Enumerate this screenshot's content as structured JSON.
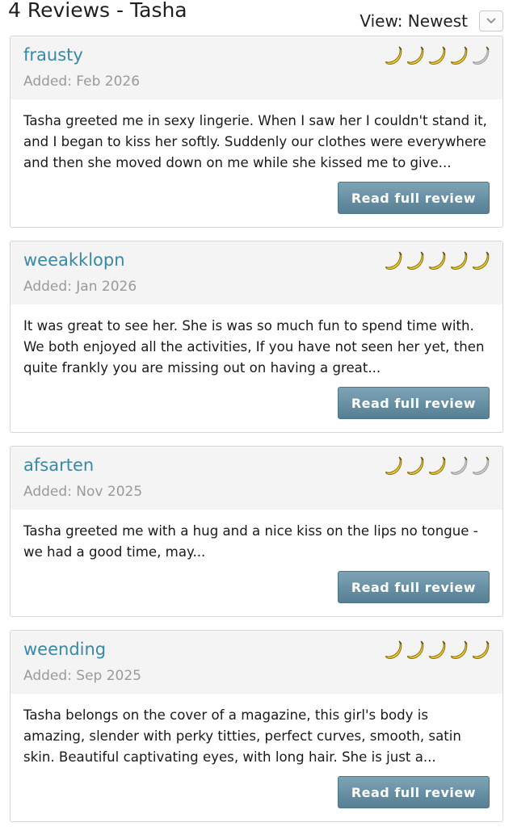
{
  "header": {
    "title": "4 Reviews - Tasha",
    "sort_label": "View: Newest"
  },
  "colors": {
    "banana_filled": "#f0d232",
    "banana_empty": "#cfcfcf",
    "link": "#3a87a6",
    "button": "#5f8aa0"
  },
  "reviews": [
    {
      "reviewer": "frausty",
      "added": "Added: Feb 2026",
      "rating": 4,
      "max_rating": 5,
      "excerpt": "Tasha greeted me in sexy lingerie. When I saw her I couldn't stand it, and I began to kiss her softly. Suddenly our clothes were everywhere and then she moved down on me while she kissed me to give...",
      "button": "Read full review"
    },
    {
      "reviewer": "weeakklopn",
      "added": "Added: Jan 2026",
      "rating": 5,
      "max_rating": 5,
      "excerpt": "It was great to see her. She is was so much fun to spend time with. We both enjoyed all the activities, If you have not seen her yet, then quite frankly you are missing out on having a great...",
      "button": "Read full review"
    },
    {
      "reviewer": "afsarten",
      "added": "Added: Nov 2025",
      "rating": 3,
      "max_rating": 5,
      "excerpt": "Tasha greeted me with a hug and a nice kiss on the lips no tongue - we had a good time, may...",
      "button": "Read full review"
    },
    {
      "reviewer": "weending",
      "added": "Added: Sep 2025",
      "rating": 5,
      "max_rating": 5,
      "excerpt": "Tasha belongs on the cover of a magazine, this girl's body is amazing, slender with perky titties, perfect curves, smooth, satin skin. Beautiful captivating eyes, with long hair. She is just a...",
      "button": "Read full review"
    }
  ]
}
